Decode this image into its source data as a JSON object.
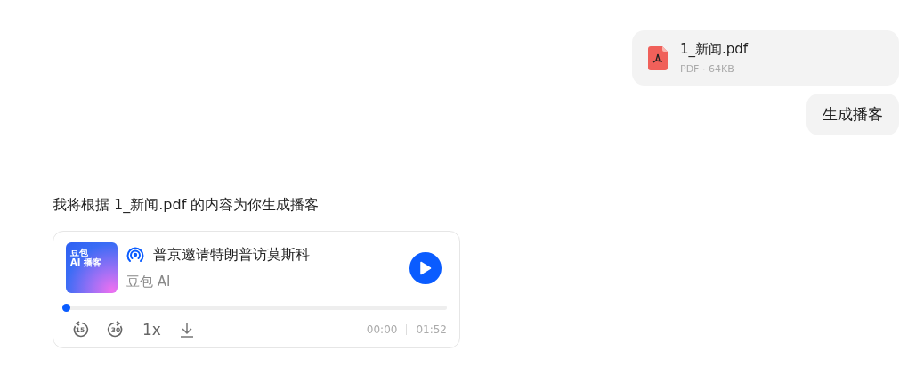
{
  "user_messages": [
    {
      "kind": "file",
      "name": "1_新闻.pdf",
      "meta": "PDF · 64KB"
    },
    {
      "kind": "text",
      "text": "生成播客"
    }
  ],
  "reply": {
    "text": "我将根据 1_新闻.pdf 的内容为你生成播客",
    "podcast": {
      "cover_title": "豆包",
      "cover_subtitle": "AI 播客",
      "title": "普京邀请特朗普访莫斯科",
      "author": "豆包 AI",
      "level": 0.0,
      "rewind": "15",
      "forward": "30",
      "speed": "1x",
      "current": "00:00",
      "total": "01:52"
    }
  }
}
